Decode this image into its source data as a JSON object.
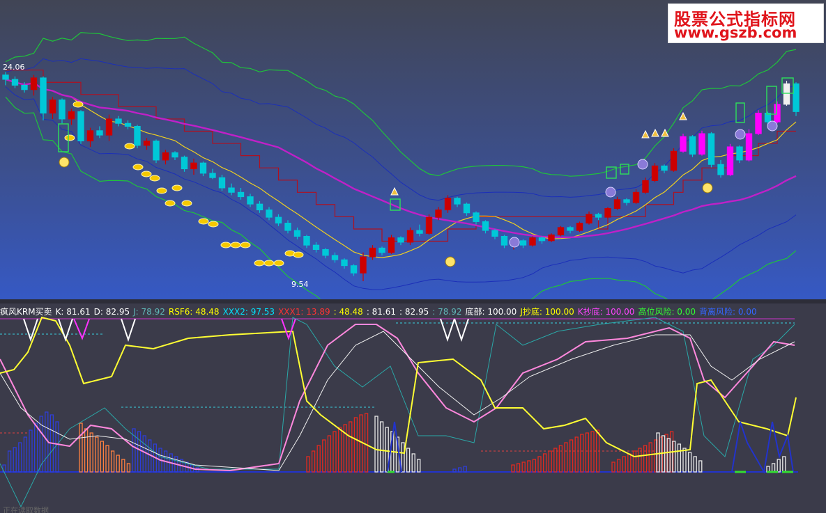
{
  "watermark": {
    "line1": "股票公式指标网",
    "line2": "www.gszb.com"
  },
  "price_labels": {
    "high": "24.06",
    "low": "9.54"
  },
  "indicator_header": [
    {
      "text": "疯风KRM买卖",
      "color": "#ffffff"
    },
    {
      "text": "K: 81.61",
      "color": "#ffffff"
    },
    {
      "text": "D: 82.95",
      "color": "#ffffff"
    },
    {
      "text": "J: 78.92",
      "color": "#5fb8b8"
    },
    {
      "text": "RSF6: 48.48",
      "color": "#ffff00"
    },
    {
      "text": "XXX2: 97.53",
      "color": "#00e5ff"
    },
    {
      "text": "XXX1: 13.89",
      "color": "#ff3333"
    },
    {
      "text": ": 48.48",
      "color": "#ffff00"
    },
    {
      "text": ": 81.61",
      "color": "#ffffff"
    },
    {
      "text": ": 82.95",
      "color": "#ffffff"
    },
    {
      "text": ": 78.92",
      "color": "#5fb8b8"
    },
    {
      "text": "底部: 100.00",
      "color": "#ffffff"
    },
    {
      "text": "J抄底: 100.00",
      "color": "#ffff00"
    },
    {
      "text": "K抄底: 100.00",
      "color": "#ff44ff"
    },
    {
      "text": "高位风险: 0.00",
      "color": "#33ff33"
    },
    {
      "text": "背离风险: 0.00",
      "color": "#3366ff"
    }
  ],
  "footer": {
    "text": "正在读取数据"
  },
  "colors": {
    "up": "#cc0000",
    "down": "#00c8d8",
    "magenta": "#ff00ff",
    "yellow": "#ffff33",
    "green": "#22cc44",
    "blue": "#2233cc"
  },
  "chart_data": [
    {
      "type": "candlestick",
      "ylim": [
        8,
        28
      ],
      "y_labels": {
        "high": 24.06,
        "low": 9.54
      },
      "candles": [
        [
          23.6,
          23.8,
          22.9,
          23.3
        ],
        [
          23.3,
          23.5,
          22.7,
          22.9
        ],
        [
          22.9,
          23.1,
          22.4,
          22.6
        ],
        [
          22.6,
          23.6,
          22.2,
          23.4
        ],
        [
          23.4,
          23.5,
          20.5,
          21.0
        ],
        [
          21.0,
          22.1,
          20.6,
          21.9
        ],
        [
          21.9,
          22.0,
          20.3,
          20.6
        ],
        [
          20.6,
          21.3,
          20.2,
          21.1
        ],
        [
          21.1,
          21.2,
          18.9,
          19.1
        ],
        [
          19.1,
          20.0,
          18.7,
          19.8
        ],
        [
          19.8,
          20.1,
          19.3,
          19.5
        ],
        [
          19.5,
          20.9,
          19.1,
          20.6
        ],
        [
          20.6,
          20.8,
          20.1,
          20.3
        ],
        [
          20.3,
          20.5,
          19.9,
          20.1
        ],
        [
          20.1,
          20.2,
          18.6,
          18.8
        ],
        [
          18.8,
          19.3,
          18.5,
          19.1
        ],
        [
          19.1,
          19.2,
          17.6,
          17.8
        ],
        [
          17.8,
          18.5,
          17.5,
          18.3
        ],
        [
          18.3,
          18.4,
          17.8,
          18.0
        ],
        [
          18.0,
          18.1,
          17.0,
          17.2
        ],
        [
          17.2,
          17.9,
          16.8,
          17.6
        ],
        [
          17.6,
          17.7,
          16.7,
          16.9
        ],
        [
          16.9,
          17.2,
          16.5,
          16.6
        ],
        [
          16.6,
          16.8,
          15.7,
          15.9
        ],
        [
          15.9,
          16.2,
          15.4,
          15.6
        ],
        [
          15.6,
          15.9,
          15.1,
          15.3
        ],
        [
          15.3,
          15.5,
          14.6,
          14.8
        ],
        [
          14.8,
          15.0,
          14.2,
          14.4
        ],
        [
          14.4,
          14.6,
          13.7,
          13.9
        ],
        [
          13.9,
          14.1,
          13.3,
          13.5
        ],
        [
          13.5,
          13.7,
          12.8,
          13.0
        ],
        [
          13.0,
          13.2,
          12.4,
          12.6
        ],
        [
          12.6,
          12.7,
          11.8,
          12.0
        ],
        [
          12.0,
          12.2,
          11.5,
          11.7
        ],
        [
          11.7,
          11.8,
          11.1,
          11.3
        ],
        [
          11.3,
          11.5,
          10.8,
          11.0
        ],
        [
          11.0,
          11.1,
          10.4,
          10.6
        ],
        [
          10.6,
          10.7,
          9.9,
          10.1
        ],
        [
          10.1,
          11.5,
          9.54,
          11.2
        ],
        [
          11.2,
          12.0,
          11.0,
          11.8
        ],
        [
          11.8,
          11.9,
          11.3,
          11.5
        ],
        [
          11.5,
          12.7,
          11.4,
          12.5
        ],
        [
          12.5,
          12.6,
          12.0,
          12.2
        ],
        [
          12.2,
          13.2,
          12.0,
          13.0
        ],
        [
          13.0,
          13.4,
          12.6,
          12.8
        ],
        [
          12.8,
          14.1,
          12.7,
          13.9
        ],
        [
          13.9,
          14.6,
          13.7,
          14.4
        ],
        [
          14.4,
          15.4,
          14.2,
          15.2
        ],
        [
          15.2,
          15.3,
          14.6,
          14.8
        ],
        [
          14.8,
          14.9,
          14.0,
          14.2
        ],
        [
          14.2,
          14.3,
          13.4,
          13.6
        ],
        [
          13.6,
          13.7,
          12.8,
          13.0
        ],
        [
          13.0,
          13.1,
          12.4,
          12.6
        ],
        [
          12.6,
          12.7,
          11.8,
          12.0
        ],
        [
          12.0,
          12.5,
          11.7,
          12.3
        ],
        [
          12.3,
          12.4,
          11.8,
          12.0
        ],
        [
          12.0,
          12.6,
          11.9,
          12.5
        ],
        [
          12.5,
          12.6,
          12.1,
          12.3
        ],
        [
          12.3,
          12.8,
          12.2,
          12.7
        ],
        [
          12.7,
          13.3,
          12.6,
          13.2
        ],
        [
          13.2,
          13.3,
          12.8,
          13.0
        ],
        [
          13.0,
          13.6,
          12.9,
          13.5
        ],
        [
          13.5,
          14.3,
          13.4,
          14.1
        ],
        [
          14.1,
          14.2,
          13.7,
          13.9
        ],
        [
          13.9,
          14.6,
          13.8,
          14.5
        ],
        [
          14.5,
          15.3,
          14.4,
          15.1
        ],
        [
          15.1,
          15.2,
          14.7,
          14.9
        ],
        [
          14.9,
          15.8,
          14.8,
          15.6
        ],
        [
          15.6,
          16.6,
          15.5,
          16.4
        ],
        [
          16.4,
          17.6,
          16.3,
          17.4
        ],
        [
          17.4,
          17.5,
          16.9,
          17.1
        ],
        [
          17.1,
          18.6,
          17.0,
          18.4
        ],
        [
          18.4,
          19.6,
          18.3,
          19.4
        ],
        [
          19.4,
          19.5,
          18.0,
          18.2
        ],
        [
          18.2,
          19.8,
          18.1,
          19.6
        ],
        [
          19.6,
          19.7,
          17.3,
          17.5
        ],
        [
          17.5,
          17.8,
          16.6,
          16.8
        ],
        [
          16.8,
          18.9,
          16.7,
          18.7
        ],
        [
          18.7,
          18.8,
          17.6,
          17.8
        ],
        [
          17.8,
          19.9,
          17.7,
          19.6
        ],
        [
          19.6,
          21.2,
          19.5,
          21.0
        ],
        [
          21.0,
          21.1,
          20.2,
          20.4
        ],
        [
          20.4,
          21.8,
          20.3,
          21.6
        ],
        [
          21.6,
          23.2,
          21.5,
          23.0
        ],
        [
          23.0,
          23.1,
          20.8,
          21.1
        ]
      ]
    },
    {
      "type": "indicator",
      "name": "疯风KRM买卖",
      "series_names": [
        "K",
        "D",
        "J",
        "RSF6",
        "XXX2",
        "XXX1"
      ],
      "last_values": {
        "K": 81.61,
        "D": 82.95,
        "J": 78.92,
        "RSF6": 48.48,
        "XXX2": 97.53,
        "XXX1": 13.89
      }
    }
  ]
}
